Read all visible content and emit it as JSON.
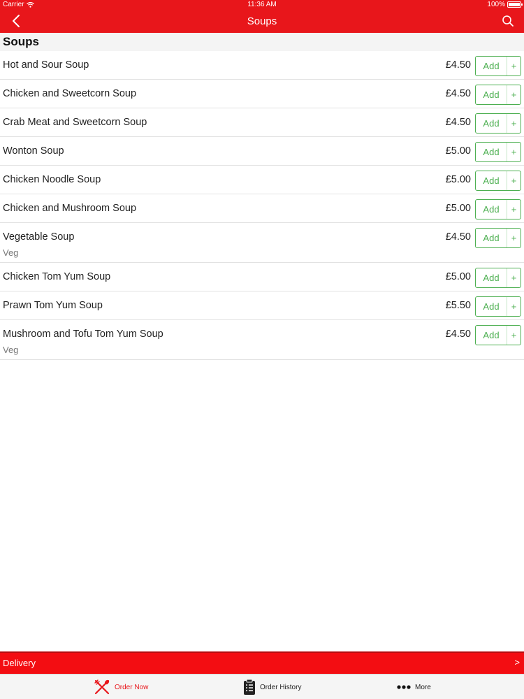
{
  "status_bar": {
    "carrier": "Carrier",
    "time": "11:36 AM",
    "battery": "100%"
  },
  "nav": {
    "title": "Soups",
    "back_icon": "chevron-left-icon",
    "search_icon": "search-icon"
  },
  "section": {
    "title": "Soups"
  },
  "items": [
    {
      "name": "Hot and Sour Soup",
      "price": "£4.50",
      "add_label": "Add",
      "plus": "+",
      "tag": ""
    },
    {
      "name": "Chicken and Sweetcorn Soup",
      "price": "£4.50",
      "add_label": "Add",
      "plus": "+",
      "tag": ""
    },
    {
      "name": "Crab Meat and Sweetcorn Soup",
      "price": "£4.50",
      "add_label": "Add",
      "plus": "+",
      "tag": ""
    },
    {
      "name": "Wonton Soup",
      "price": "£5.00",
      "add_label": "Add",
      "plus": "+",
      "tag": ""
    },
    {
      "name": "Chicken Noodle Soup",
      "price": "£5.00",
      "add_label": "Add",
      "plus": "+",
      "tag": ""
    },
    {
      "name": "Chicken and Mushroom Soup",
      "price": "£5.00",
      "add_label": "Add",
      "plus": "+",
      "tag": ""
    },
    {
      "name": "Vegetable Soup",
      "price": "£4.50",
      "add_label": "Add",
      "plus": "+",
      "tag": "Veg"
    },
    {
      "name": "Chicken Tom Yum Soup",
      "price": "£5.00",
      "add_label": "Add",
      "plus": "+",
      "tag": ""
    },
    {
      "name": "Prawn Tom Yum Soup",
      "price": "£5.50",
      "add_label": "Add",
      "plus": "+",
      "tag": ""
    },
    {
      "name": "Mushroom and Tofu Tom Yum Soup",
      "price": "£4.50",
      "add_label": "Add",
      "plus": "+",
      "tag": "Veg"
    }
  ],
  "delivery": {
    "label": "Delivery",
    "arrow": ">"
  },
  "tabs": [
    {
      "label": "Order Now",
      "icon": "fork-knife-icon",
      "active": true
    },
    {
      "label": "Order History",
      "icon": "clipboard-icon",
      "active": false
    },
    {
      "label": "More",
      "icon": "more-dots-icon",
      "active": false
    }
  ],
  "colors": {
    "brand_red": "#e8161b",
    "add_green": "#4caf50"
  }
}
